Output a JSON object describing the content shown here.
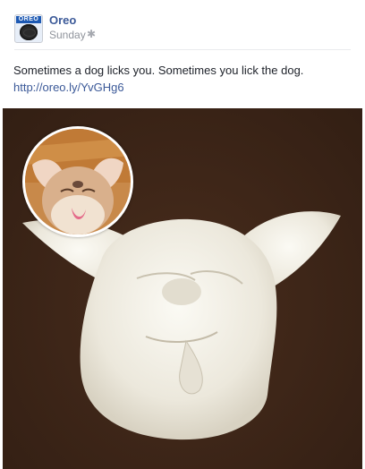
{
  "post": {
    "page_name": "Oreo",
    "timestamp": "Sunday",
    "message": "Sometimes a dog licks you. Sometimes you lick the dog.",
    "link": "http://oreo.ly/YvGHg6"
  },
  "avatar": {
    "logo_text": "OREO",
    "icon": "oreo-cookie-icon"
  },
  "icons": {
    "privacy": "gear-icon"
  },
  "colors": {
    "link": "#3b5998",
    "text": "#1d2129",
    "meta": "#90949c",
    "photo_bg": "#43291a",
    "sculpture": "#f1efe6"
  }
}
